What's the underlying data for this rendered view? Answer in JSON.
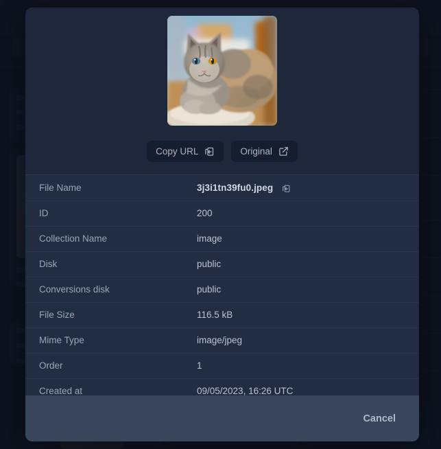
{
  "modal": {
    "preview": {
      "image_alt": "cat-photo-thumbnail",
      "copy_url_label": "Copy URL",
      "copy_url_icon": "clipboard-copy-icon",
      "original_label": "Original",
      "original_icon": "external-link-icon"
    },
    "details": {
      "rows": [
        {
          "key": "File Name",
          "value": "3j3i1tn39fu0.jpeg",
          "bold": true,
          "copy_icon": "clipboard-copy-icon"
        },
        {
          "key": "ID",
          "value": "200"
        },
        {
          "key": "Collection Name",
          "value": "image"
        },
        {
          "key": "Disk",
          "value": "public"
        },
        {
          "key": "Conversions disk",
          "value": "public"
        },
        {
          "key": "File Size",
          "value": "116.5 kB"
        },
        {
          "key": "Mime Type",
          "value": "image/jpeg"
        },
        {
          "key": "Order",
          "value": "1"
        },
        {
          "key": "Created at",
          "value": "09/05/2023, 16:26 UTC"
        }
      ]
    },
    "footer": {
      "cancel_label": "Cancel"
    }
  },
  "colors": {
    "modal_background": "#1f283a",
    "row_background": "#232d41",
    "row_divider": "#2b3549",
    "footer_background": "#39455a",
    "key_text": "#9aa5b6",
    "value_text": "#b9c3d1",
    "button_background": "#161d2c",
    "page_background": "#131a29",
    "scrim": "rgba(10,15,26,0.72)"
  }
}
